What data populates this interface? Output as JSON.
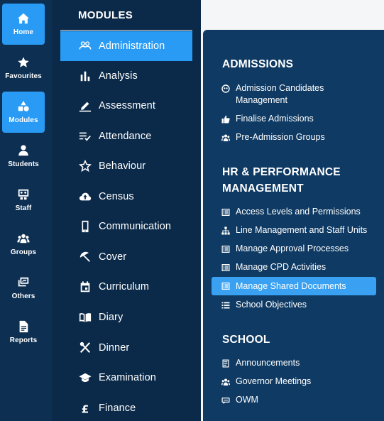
{
  "rail": {
    "items": [
      {
        "label": "Home",
        "icon": "home-icon",
        "active": true
      },
      {
        "label": "Favourites",
        "icon": "star-icon",
        "active": false
      },
      {
        "label": "Modules",
        "icon": "shapes-icon",
        "active": true
      },
      {
        "label": "Students",
        "icon": "person-icon",
        "active": false
      },
      {
        "label": "Staff",
        "icon": "staff-board-icon",
        "active": false
      },
      {
        "label": "Groups",
        "icon": "users-icon",
        "active": false
      },
      {
        "label": "Others",
        "icon": "others-icon",
        "active": false
      },
      {
        "label": "Reports",
        "icon": "document-icon",
        "active": false
      }
    ]
  },
  "modules": {
    "title": "MODULES",
    "items": [
      {
        "label": "Administration",
        "icon": "people-outline-icon",
        "active": true
      },
      {
        "label": "Analysis",
        "icon": "bar-chart-icon",
        "active": false
      },
      {
        "label": "Assessment",
        "icon": "pencil-icon",
        "active": false
      },
      {
        "label": "Attendance",
        "icon": "checklist-icon",
        "active": false
      },
      {
        "label": "Behaviour",
        "icon": "star-outline-icon",
        "active": false
      },
      {
        "label": "Census",
        "icon": "cloud-upload-icon",
        "active": false
      },
      {
        "label": "Communication",
        "icon": "phone-icon",
        "active": false
      },
      {
        "label": "Cover",
        "icon": "umbrella-icon",
        "active": false
      },
      {
        "label": "Curriculum",
        "icon": "calendar-icon",
        "active": false
      },
      {
        "label": "Diary",
        "icon": "book-icon",
        "active": false
      },
      {
        "label": "Dinner",
        "icon": "cutlery-icon",
        "active": false
      },
      {
        "label": "Examination",
        "icon": "graduation-cap-icon",
        "active": false
      },
      {
        "label": "Finance",
        "icon": "pound-icon",
        "active": false
      }
    ]
  },
  "flyout": {
    "sections": [
      {
        "title": "ADMISSIONS",
        "items": [
          {
            "label": "Admission Candidates Management",
            "icon": "candidate-icon"
          },
          {
            "label": "Finalise Admissions",
            "icon": "thumbs-up-icon"
          },
          {
            "label": "Pre-Admission Groups",
            "icon": "group-icon"
          }
        ]
      },
      {
        "title": "HR & PERFORMANCE MANAGEMENT",
        "items": [
          {
            "label": "Access Levels and Permissions",
            "icon": "list-box-icon"
          },
          {
            "label": "Line Management and Staff Units",
            "icon": "sitemap-icon"
          },
          {
            "label": "Manage Approval Processes",
            "icon": "list-box-icon"
          },
          {
            "label": "Manage CPD Activities",
            "icon": "list-box-icon"
          },
          {
            "label": "Manage Shared Documents",
            "icon": "list-box-icon",
            "active": true
          },
          {
            "label": "School Objectives",
            "icon": "list-icon"
          }
        ]
      },
      {
        "title": "SCHOOL",
        "items": [
          {
            "label": "Announcements",
            "icon": "announcement-icon"
          },
          {
            "label": "Governor Meetings",
            "icon": "group-icon"
          },
          {
            "label": "OWM",
            "icon": "owm-icon"
          }
        ]
      }
    ]
  },
  "colors": {
    "accent": "#2a9bf4",
    "rail_bg": "#0d2f52",
    "modules_bg": "#0b2a49",
    "flyout_bg": "#0f3a63"
  }
}
